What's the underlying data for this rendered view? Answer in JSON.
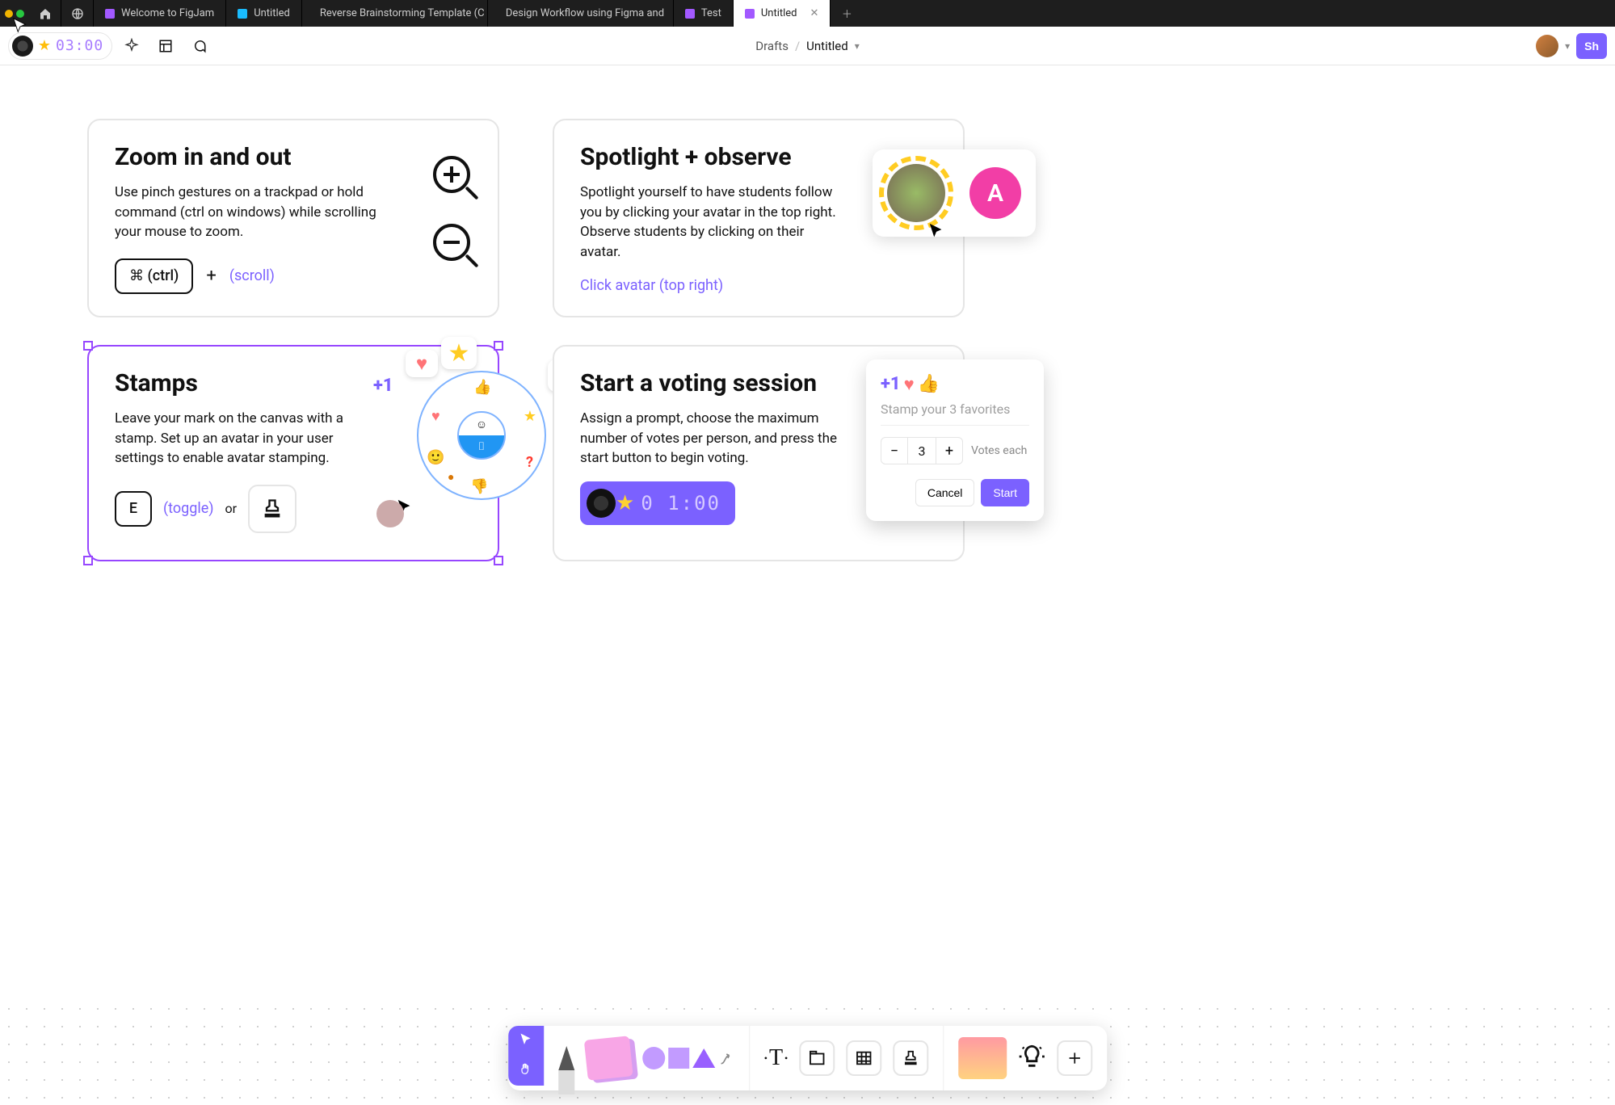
{
  "tabs": [
    {
      "label": "Welcome to FigJam",
      "type": "purple",
      "active": false
    },
    {
      "label": "Untitled",
      "type": "teal",
      "active": false
    },
    {
      "label": "Reverse Brainstorming Template (C",
      "type": "purple",
      "active": false
    },
    {
      "label": "Design Workflow using Figma and",
      "type": "purple",
      "active": false
    },
    {
      "label": "Test",
      "type": "purple",
      "active": false
    },
    {
      "label": "Untitled",
      "type": "purple",
      "active": true
    }
  ],
  "toolbar": {
    "timer": "03:00",
    "breadcrumb_root": "Drafts",
    "breadcrumb_title": "Untitled",
    "share_label": "Sh"
  },
  "cards": {
    "zoom": {
      "title": "Zoom in and out",
      "body": "Use pinch gestures on a trackpad or hold command (ctrl on windows) while scrolling your mouse to zoom.",
      "key_label": "⌘ (ctrl)",
      "plus": "+",
      "hint": "(scroll)"
    },
    "spotlight": {
      "title": "Spotlight + observe",
      "body": "Spotlight yourself to have students follow you by clicking your avatar in the top right. Observe students by clicking on their avatar.",
      "link": "Click avatar (top right)",
      "avatar_letter": "A"
    },
    "stamps": {
      "title": "Stamps",
      "body": "Leave your mark on the canvas with a stamp. Set up an avatar in your user settings to enable avatar stamping.",
      "key_label": "E",
      "toggle_hint": "(toggle)",
      "or": "or",
      "plusone": "+1"
    },
    "voting": {
      "title": "Start a voting session",
      "body": "Assign a prompt, choose the maximum number of votes per person, and press the start button to begin voting.",
      "timer": "0 1:00",
      "panel_prompt": "Stamp your 3 favorites",
      "votes_label": "Votes each",
      "votes_value": "3",
      "cancel": "Cancel",
      "start": "Start"
    }
  },
  "tray": {
    "text_tool": "T"
  }
}
